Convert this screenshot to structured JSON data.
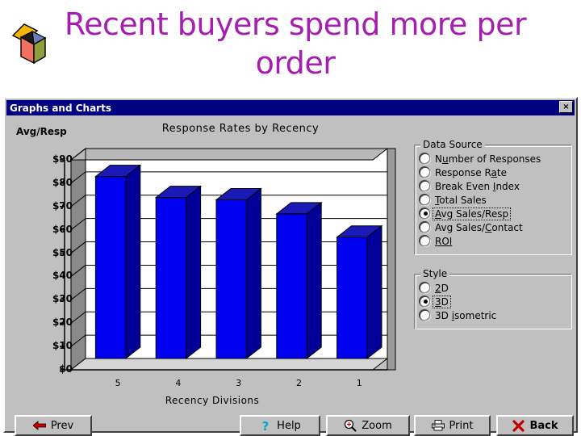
{
  "slide": {
    "title": "Recent buyers spend more per order",
    "title_color": "#a51eb0",
    "bullet_icon": "open-box-icon"
  },
  "window": {
    "title": "Graphs and Charts",
    "titlebar_color": "#000080",
    "close_label": "×"
  },
  "chart_data": {
    "type": "bar",
    "title": "Response Rates by Recency",
    "xlabel": "Recency Divisions",
    "ylabel": "Avg/Resp",
    "categories": [
      "5",
      "4",
      "3",
      "2",
      "1"
    ],
    "values": [
      78,
      69,
      68,
      62,
      52
    ],
    "ylim": [
      0,
      90
    ],
    "ytick_labels": [
      "$90",
      "$80",
      "$70",
      "$60",
      "$50",
      "$40",
      "$30",
      "$20",
      "$10",
      "$0"
    ],
    "ytick_values": [
      90,
      80,
      70,
      60,
      50,
      40,
      30,
      20,
      10,
      0
    ],
    "grid": true,
    "legend": "none",
    "style": "3D",
    "bar_color": "#0000f0",
    "bar_side_color": "#000099",
    "bar_top_color": "#1a1ab5"
  },
  "panel": {
    "data_source": {
      "legend": "Data Source",
      "options": [
        {
          "label": "Number of Responses",
          "acc": "u",
          "selected": false
        },
        {
          "label": "Response Rate",
          "acc": "a",
          "selected": false
        },
        {
          "label": "Break Even Index",
          "acc": "I",
          "selected": false
        },
        {
          "label": "Total Sales",
          "acc": "T",
          "selected": false
        },
        {
          "label": "Avg Sales/Resp",
          "acc": "A",
          "selected": true
        },
        {
          "label": "Avg Sales/Contact",
          "acc": "C",
          "selected": false
        },
        {
          "label": "ROI",
          "acc": "ROI",
          "selected": false
        }
      ]
    },
    "style": {
      "legend": "Style",
      "options": [
        {
          "label": "2D",
          "acc": "2",
          "selected": false
        },
        {
          "label": "3D",
          "acc": "3",
          "selected": true
        },
        {
          "label": "3D isometric",
          "acc": "i",
          "selected": false
        }
      ]
    }
  },
  "buttons": {
    "prev": {
      "label": "Prev",
      "acc": "P",
      "icon": "left-arrow-icon",
      "icon_color": "#d00000"
    },
    "help": {
      "label": "Help",
      "acc": "H",
      "icon": "question-mark-icon",
      "icon_color": "#00a0c0"
    },
    "zoom": {
      "label": "Zoom",
      "acc": "Z",
      "icon": "magnifier-plus-icon",
      "icon_color": "#000000"
    },
    "print": {
      "label": "Print",
      "acc": "r",
      "icon": "printer-icon",
      "icon_color": "#000000"
    },
    "back": {
      "label": "Back",
      "acc": "k",
      "icon": "red-x-icon",
      "icon_color": "#c00000"
    }
  }
}
